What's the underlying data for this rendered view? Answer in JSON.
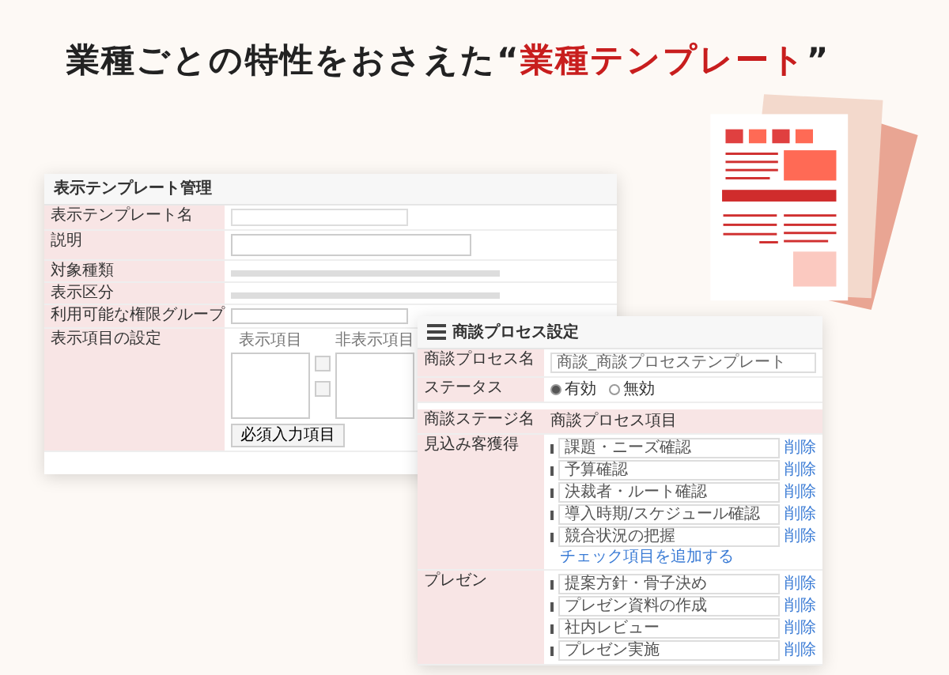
{
  "headline": {
    "text": "業種ごとの特性をおさえた",
    "quote_open": "“",
    "highlight": "業種テンプレート",
    "quote_close": "”"
  },
  "template_window": {
    "title": "表示テンプレート管理",
    "rows": [
      {
        "label": "表示テンプレート名",
        "kind": "input"
      },
      {
        "label": "説明",
        "kind": "textarea"
      },
      {
        "label": "対象種類",
        "kind": "text"
      },
      {
        "label": "表示区分",
        "kind": "text"
      },
      {
        "label": "利用可能な権限グループ",
        "kind": "select"
      },
      {
        "label": "表示項目の設定",
        "kind": "lists"
      }
    ],
    "shown_header": "表示項目",
    "hidden_header": "非表示項目",
    "required_button": "必須入力項目"
  },
  "process_window": {
    "title": "商談プロセス設定",
    "name_label": "商談プロセス名",
    "name_value": "商談_商談プロセステンプレート",
    "status_label": "ステータス",
    "status_options": [
      {
        "label": "有効",
        "selected": true
      },
      {
        "label": "無効",
        "selected": false
      }
    ],
    "stage_header": "商談ステージ名",
    "item_header": "商談プロセス項目",
    "stages": [
      {
        "name": "見込み客獲得",
        "items": [
          {
            "label": "課題・ニーズ確認",
            "delete": "削除"
          },
          {
            "label": "予算確認",
            "delete": "削除"
          },
          {
            "label": "決裁者・ルート確認",
            "delete": "削除"
          },
          {
            "label": "導入時期/スケジュール確認",
            "delete": "削除"
          },
          {
            "label": "競合状況の把握",
            "delete": "削除"
          }
        ],
        "add_link": "チェック項目を追加する"
      },
      {
        "name": "プレゼン",
        "items": [
          {
            "label": "提案方針・骨子決め",
            "delete": "削除"
          },
          {
            "label": "プレゼン資料の作成",
            "delete": "削除"
          },
          {
            "label": "社内レビュー",
            "delete": "削除"
          },
          {
            "label": "プレゼン実施",
            "delete": "削除"
          }
        ]
      }
    ]
  }
}
